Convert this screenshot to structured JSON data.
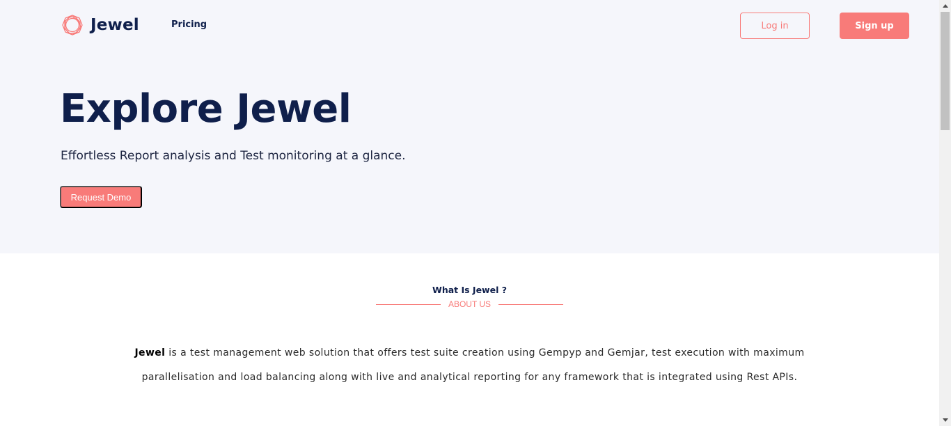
{
  "header": {
    "logo_text": "Jewel",
    "nav": {
      "pricing_label": "Pricing"
    },
    "login_label": "Log in",
    "signup_label": "Sign up"
  },
  "hero": {
    "title": "Explore Jewel",
    "subtitle": "Effortless Report analysis and Test monitoring at a glance.",
    "demo_label": "Request Demo"
  },
  "about": {
    "heading": "What Is Jewel ?",
    "label": "ABOUT US",
    "body_strong": "Jewel",
    "body_text": " is a test management web solution that offers test suite creation using Gempyp and Gemjar, test execution with maximum parallelisation and load balancing along with live and analytical reporting for any framework that is integrated using Rest APIs."
  },
  "colors": {
    "accent": "#f87b79",
    "navy": "#0f1f4b",
    "hero_bg": "#f5f6fb"
  },
  "icons": {
    "logo": "polygon-ring-logo-icon",
    "scroll_up": "triangle-up-icon",
    "scroll_down": "triangle-down-icon"
  }
}
